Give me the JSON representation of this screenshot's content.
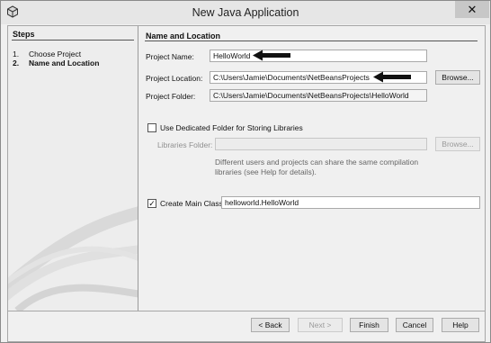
{
  "window": {
    "title": "New Java Application",
    "close_glyph": "✕"
  },
  "steps": {
    "title": "Steps",
    "items": [
      {
        "num": "1.",
        "label": "Choose Project"
      },
      {
        "num": "2.",
        "label": "Name and Location"
      }
    ]
  },
  "form": {
    "section_title": "Name and Location",
    "project_name": {
      "label": "Project Name:",
      "value": "HelloWorld"
    },
    "project_location": {
      "label": "Project Location:",
      "value": "C:\\Users\\Jamie\\Documents\\NetBeansProjects",
      "browse": "Browse..."
    },
    "project_folder": {
      "label": "Project Folder:",
      "value": "C:\\Users\\Jamie\\Documents\\NetBeansProjects\\HelloWorld"
    },
    "dedicated_folder": {
      "label": "Use Dedicated Folder for Storing Libraries",
      "checked": false
    },
    "libraries_folder": {
      "label": "Libraries Folder:",
      "value": "",
      "browse": "Browse..."
    },
    "note_line1": "Different users and projects can share the same compilation",
    "note_line2": "libraries (see Help for details).",
    "create_main_class": {
      "label": "Create Main Class",
      "checked": true,
      "check_glyph": "✓",
      "value": "helloworld.HelloWorld"
    }
  },
  "buttons": {
    "back": "< Back",
    "next": "Next >",
    "finish": "Finish",
    "cancel": "Cancel",
    "help": "Help"
  },
  "icons": {
    "app": "netbeans-cube-icon",
    "close": "close-icon",
    "pointer": "pointer-arrow-icon"
  }
}
